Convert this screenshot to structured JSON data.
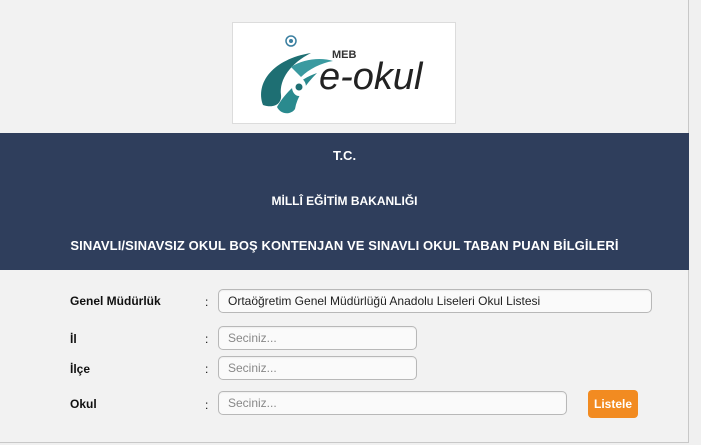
{
  "logo": {
    "brand_top": "MEB",
    "brand_name": "e-okul"
  },
  "header": {
    "line1": "T.C.",
    "line2": "MİLLÎ EĞİTİM BAKANLIĞI",
    "line3": "SINAVLI/SINAVSIZ OKUL BOŞ KONTENJAN VE SINAVLI OKUL TABAN PUAN BİLGİLERİ"
  },
  "form": {
    "separator": ":",
    "genel_mudurluk": {
      "label": "Genel Müdürlük",
      "value": "Ortaöğretim Genel Müdürlüğü Anadolu Liseleri Okul Listesi"
    },
    "il": {
      "label": "İl",
      "placeholder": "Seciniz..."
    },
    "ilce": {
      "label": "İlçe",
      "placeholder": "Seciniz..."
    },
    "okul": {
      "label": "Okul",
      "placeholder": "Seciniz..."
    },
    "list_button_label": "Listele"
  },
  "colors": {
    "banner_bg": "#2f3e5c",
    "button_bg": "#f28b21",
    "logo_teal": "#1e6f73"
  }
}
